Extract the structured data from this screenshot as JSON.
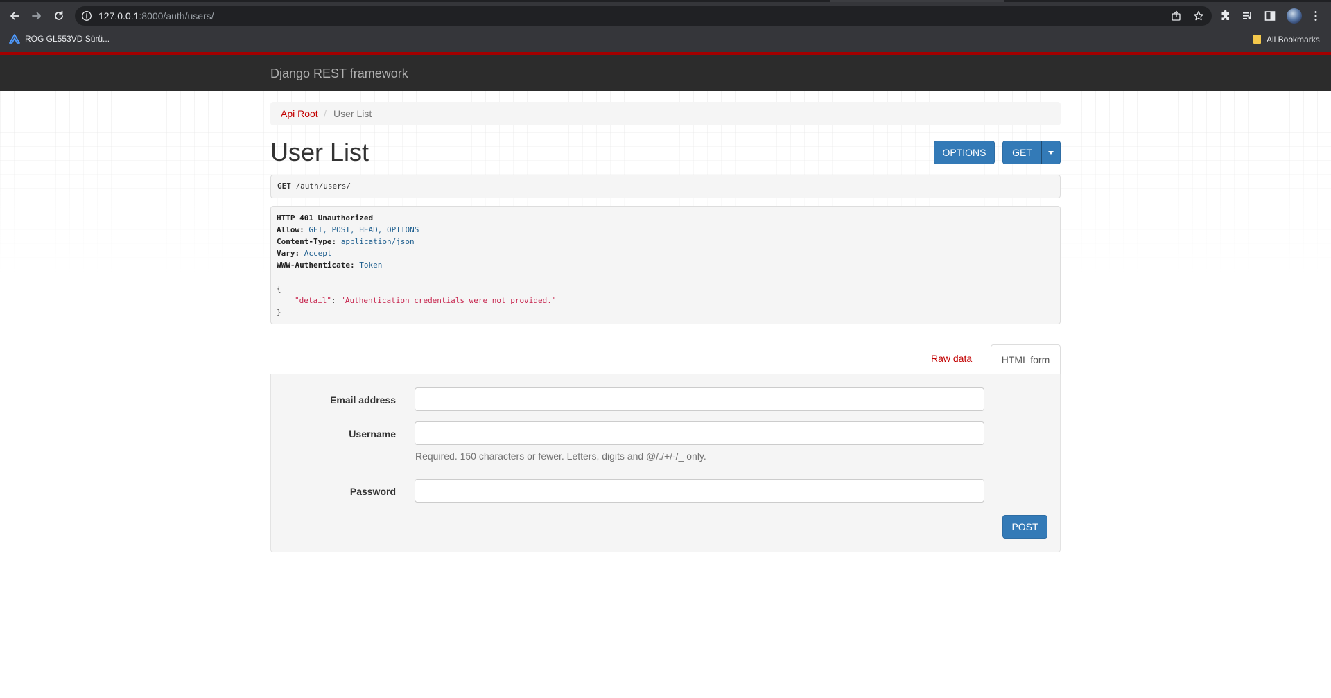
{
  "browser": {
    "url_host": "127.0.0.1",
    "url_path": ":8000/auth/users/",
    "bookmarks": [
      {
        "label": "ROG GL553VD Sürü..."
      }
    ],
    "all_bookmarks_label": "All Bookmarks"
  },
  "app": {
    "brand": "Django REST framework"
  },
  "breadcrumb": {
    "root": "Api Root",
    "separator": "/",
    "current": "User List"
  },
  "page": {
    "title": "User List",
    "options_button": "OPTIONS",
    "get_button": "GET"
  },
  "request": {
    "method": "GET",
    "path": "/auth/users/"
  },
  "response": {
    "status": "HTTP 401 Unauthorized",
    "headers": [
      {
        "key": "Allow:",
        "value": "GET, POST, HEAD, OPTIONS"
      },
      {
        "key": "Content-Type:",
        "value": "application/json"
      },
      {
        "key": "Vary:",
        "value": "Accept"
      },
      {
        "key": "WWW-Authenticate:",
        "value": "Token"
      }
    ],
    "body_open": "{",
    "body_key": "\"detail\"",
    "body_colon": ": ",
    "body_value": "\"Authentication credentials were not provided.\"",
    "body_close": "}"
  },
  "tabs": {
    "raw": "Raw data",
    "html": "HTML form"
  },
  "form": {
    "email_label": "Email address",
    "email_value": "",
    "username_label": "Username",
    "username_value": "",
    "username_help": "Required. 150 characters or fewer. Letters, digits and @/./+/-/_ only.",
    "password_label": "Password",
    "password_value": "",
    "submit": "POST"
  },
  "colors": {
    "navbar_bg": "#2c2c2c",
    "navbar_accent": "#a30000",
    "link": "#c20000",
    "button_primary": "#337ab7"
  }
}
